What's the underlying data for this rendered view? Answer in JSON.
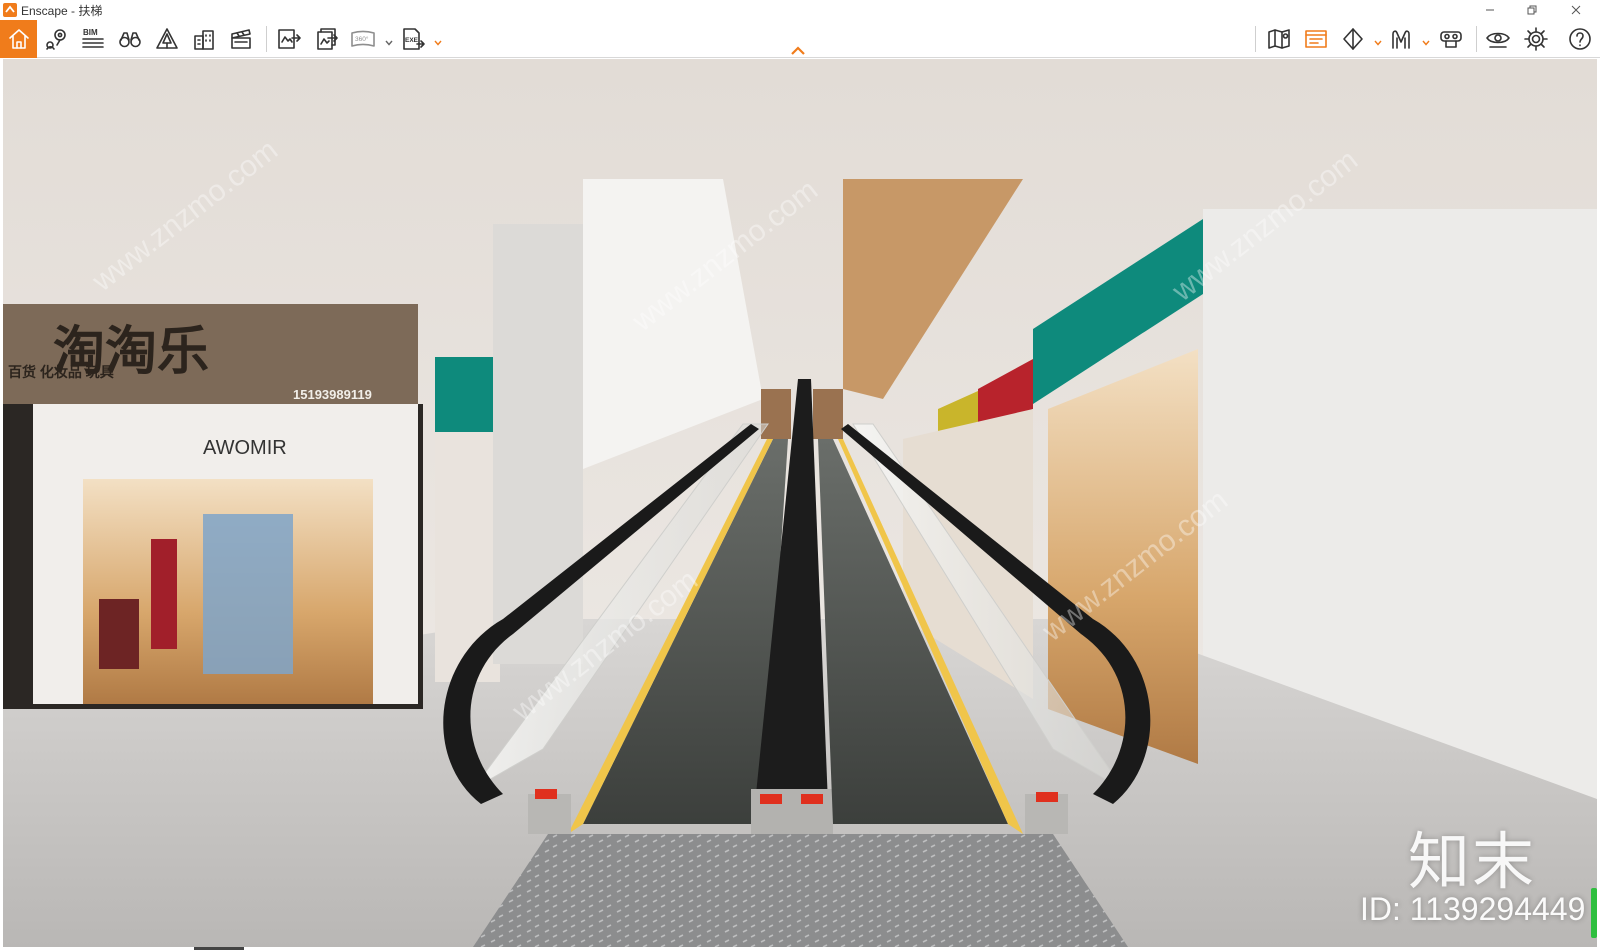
{
  "window": {
    "title": "Enscape - 扶梯",
    "controls": [
      "minimize",
      "restore",
      "close"
    ]
  },
  "toolbar": {
    "home_icon": "home-icon",
    "left_tools": [
      "asset-library-pin-icon",
      "bim-panel-icon",
      "views-binoculars-icon",
      "site-context-icon",
      "buildings-icon",
      "video-editor-clapper-icon"
    ],
    "export_tools": [
      "screenshot-export-icon",
      "batch-render-icon",
      "panorama-360-icon",
      "exe-export-icon"
    ],
    "labels": {
      "bim": "BIM",
      "pano": "360°",
      "exe": "EXE"
    },
    "right_tools": [
      "map-view-icon",
      "visual-settings-icon",
      "section-view-icon",
      "vr-headset-icon",
      "collaboration-icon",
      "visibility-eye-icon",
      "settings-gear-icon",
      "help-icon"
    ],
    "accent_color": "#f07c1b"
  },
  "viewport": {
    "scene": "3D rendered view of a shopping-mall moving walkway (travelator) flanked by storefronts",
    "signs": {
      "store_name": "淘淘乐",
      "store_subtitle": "百货 化妆品 玩具",
      "store_phone": "15193989119",
      "brand": "AWOMIR"
    },
    "watermark_text": "www.znzmo.com",
    "brand_mark": "知末",
    "image_id": "ID: 1139294449"
  }
}
